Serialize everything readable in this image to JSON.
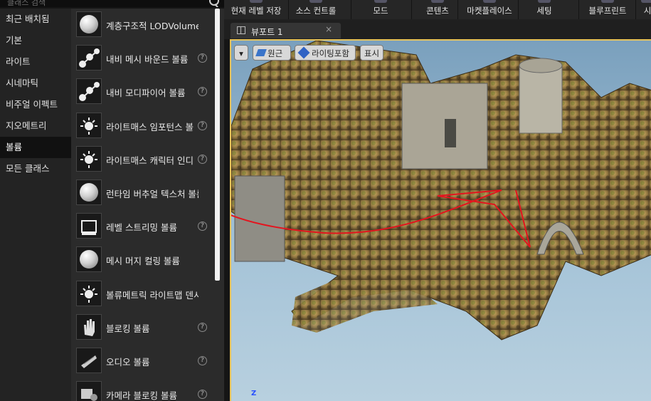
{
  "search": {
    "placeholder": "클래스 검색"
  },
  "categories": [
    "최근 배치됨",
    "기본",
    "라이트",
    "시네마틱",
    "비주얼 이펙트",
    "지오메트리",
    "볼륨",
    "모든 클래스"
  ],
  "selected_category": "볼륨",
  "items": [
    {
      "label": "계층구조적 LODVolume",
      "icon": "sphere-icon",
      "help": false
    },
    {
      "label": "내비 메시 바운드 볼륨",
      "icon": "nav-mesh-icon",
      "help": true
    },
    {
      "label": "내비 모디파이어 볼륨",
      "icon": "nav-modifier-icon",
      "help": true
    },
    {
      "label": "라이트매스 임포턴스 볼",
      "icon": "lightmass-importance-icon",
      "help": true
    },
    {
      "label": "라이트매스 캐릭터 인디",
      "icon": "lightmass-character-icon",
      "help": true
    },
    {
      "label": "런타임 버추얼 텍스처 볼륨",
      "icon": "sphere-icon",
      "help": false
    },
    {
      "label": "레벨 스트리밍 볼륨",
      "icon": "level-streaming-icon",
      "help": true
    },
    {
      "label": "메시 머지 컬링 볼륨",
      "icon": "sphere-icon",
      "help": false
    },
    {
      "label": "볼류메트릭 라이트맵 덴시티",
      "icon": "lightmap-density-icon",
      "help": false
    },
    {
      "label": "블로킹 볼륨",
      "icon": "hand-icon",
      "help": true
    },
    {
      "label": "오디오 볼륨",
      "icon": "audio-icon",
      "help": true
    },
    {
      "label": "카메라 블로킹 볼륨",
      "icon": "camera-blocking-icon",
      "help": true
    }
  ],
  "help_glyph": "?",
  "toolbar": [
    "현재 레벨 저장",
    "소스 컨트롤",
    "모드",
    "콘텐츠",
    "마켓플레이스",
    "세팅",
    "블루프린트",
    "시"
  ],
  "viewport_tab": {
    "label": "뷰포트 1",
    "close": "×"
  },
  "viewport_buttons": {
    "dropdown": "▾",
    "perspective": "원근",
    "lighting": "라이팅포함",
    "show": "표시"
  },
  "axis_label": "Z",
  "colors": {
    "annotation": "#e4141e",
    "selection_border": "#e7c35a"
  }
}
